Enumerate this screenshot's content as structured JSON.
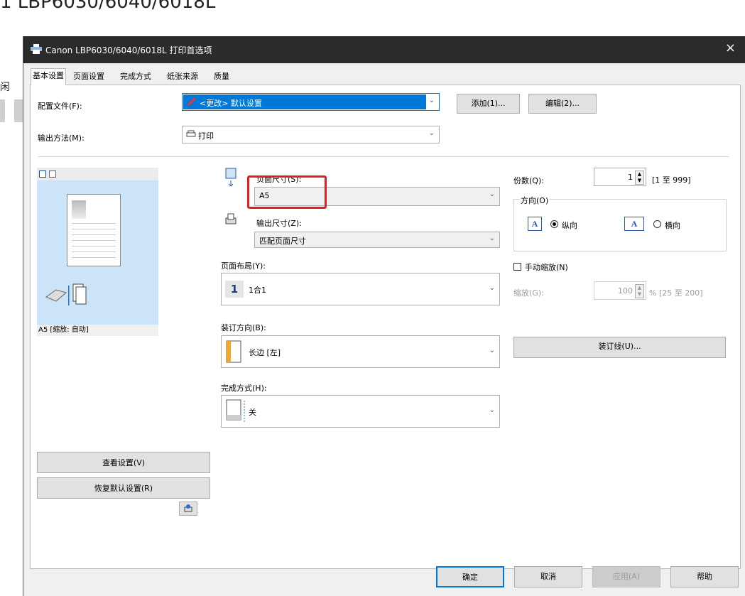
{
  "background": {
    "title_fragment": "1 LBP6030/6040/6018L",
    "left_text": "闲"
  },
  "window": {
    "title": "Canon LBP6030/6040/6018L 打印首选项",
    "close_glyph": "×"
  },
  "tabs": [
    {
      "label": "基本设置",
      "active": true
    },
    {
      "label": "页面设置",
      "active": false
    },
    {
      "label": "完成方式",
      "active": false
    },
    {
      "label": "纸张来源",
      "active": false
    },
    {
      "label": "质量",
      "active": false
    }
  ],
  "profile": {
    "label": "配置文件(F):",
    "value": "<更改> 默认设置",
    "add_button": "添加(1)...",
    "edit_button": "编辑(2)..."
  },
  "output_method": {
    "label": "输出方法(M):",
    "value": "打印"
  },
  "preview": {
    "caption": "A5 [缩放: 自动]"
  },
  "page_size": {
    "label": "页面尺寸(S):",
    "value": "A5"
  },
  "output_size": {
    "label": "输出尺寸(Z):",
    "value": "匹配页面尺寸"
  },
  "page_layout": {
    "label": "页面布局(Y):",
    "icon_number": "1",
    "value": "1合1"
  },
  "binding": {
    "label": "装订方向(B):",
    "value": "长边 [左]",
    "gutter_button": "装订线(U)..."
  },
  "finishing": {
    "label": "完成方式(H):",
    "value": "关"
  },
  "copies": {
    "label": "份数(Q):",
    "value": "1",
    "range": "[1 至 999]"
  },
  "orientation": {
    "label": "方向(O)",
    "portrait": "纵向",
    "landscape": "横向",
    "icon_glyph": "A"
  },
  "manual_scaling": {
    "label": "手动缩放(N)",
    "checked": false
  },
  "scaling": {
    "label": "缩放(G):",
    "value": "100",
    "range": "% [25 至 200]"
  },
  "left_buttons": {
    "view_settings": "查看设置(V)",
    "restore_defaults": "恢复默认设置(R)"
  },
  "footer": {
    "ok": "确定",
    "cancel": "取消",
    "apply": "应用(A)",
    "help": "帮助"
  },
  "colors": {
    "accent_blue": "#0078d7",
    "highlight_red": "#e02020",
    "titlebar": "#2b2b2b",
    "preview_bg": "#cce4f7"
  }
}
